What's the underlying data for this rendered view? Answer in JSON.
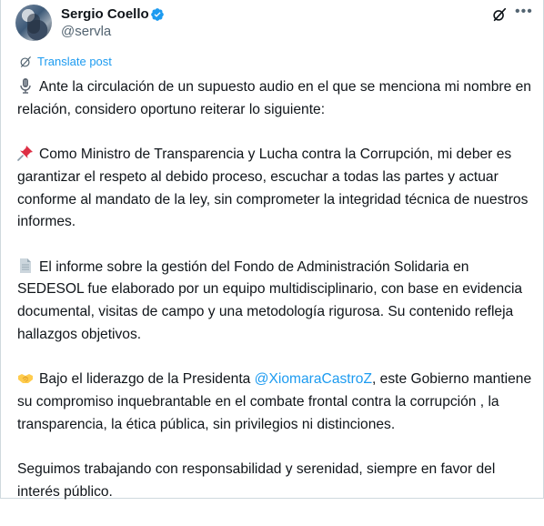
{
  "author": {
    "name": "Sergio Coello",
    "handle": "@servla"
  },
  "icons": {
    "verified": "verified-badge-icon",
    "grok": "grok-icon",
    "more": "more-options-icon",
    "translate": "translate-icon"
  },
  "colors": {
    "accent": "#1d9bf0",
    "text": "#0f1419",
    "muted": "#536471"
  },
  "translate_label": "Translate post",
  "post": {
    "p1": "Ante la circulación de un supuesto audio en el que se menciona mi nombre en relación, considero oportuno reiterar lo siguiente:",
    "p2": "Como Ministro de Transparencia y Lucha contra la Corrupción, mi deber es garantizar el respeto al debido proceso, escuchar a todas las partes y actuar conforme al mandato de la ley, sin comprometer la integridad técnica de nuestros informes.",
    "p3": "El informe sobre la gestión del Fondo de Administración Solidaria en SEDESOL fue elaborado por un equipo multidisciplinario, con base en evidencia documental, visitas de campo y una metodología rigurosa. Su contenido refleja hallazgos objetivos.",
    "p4_before": "Bajo el liderazgo de la Presidenta ",
    "p4_mention": "@XiomaraCastroZ",
    "p4_after": ", este Gobierno mantiene su compromiso inquebrantable en el combate frontal contra la corrupción , la transparencia, la ética pública, sin privilegios ni distinciones.",
    "p5": "Seguimos trabajando con responsabilidad y serenidad, siempre en favor del interés público."
  },
  "emojis": [
    "microphone-emoji",
    "pushpin-emoji",
    "page-facing-up-emoji",
    "handshake-emoji"
  ]
}
